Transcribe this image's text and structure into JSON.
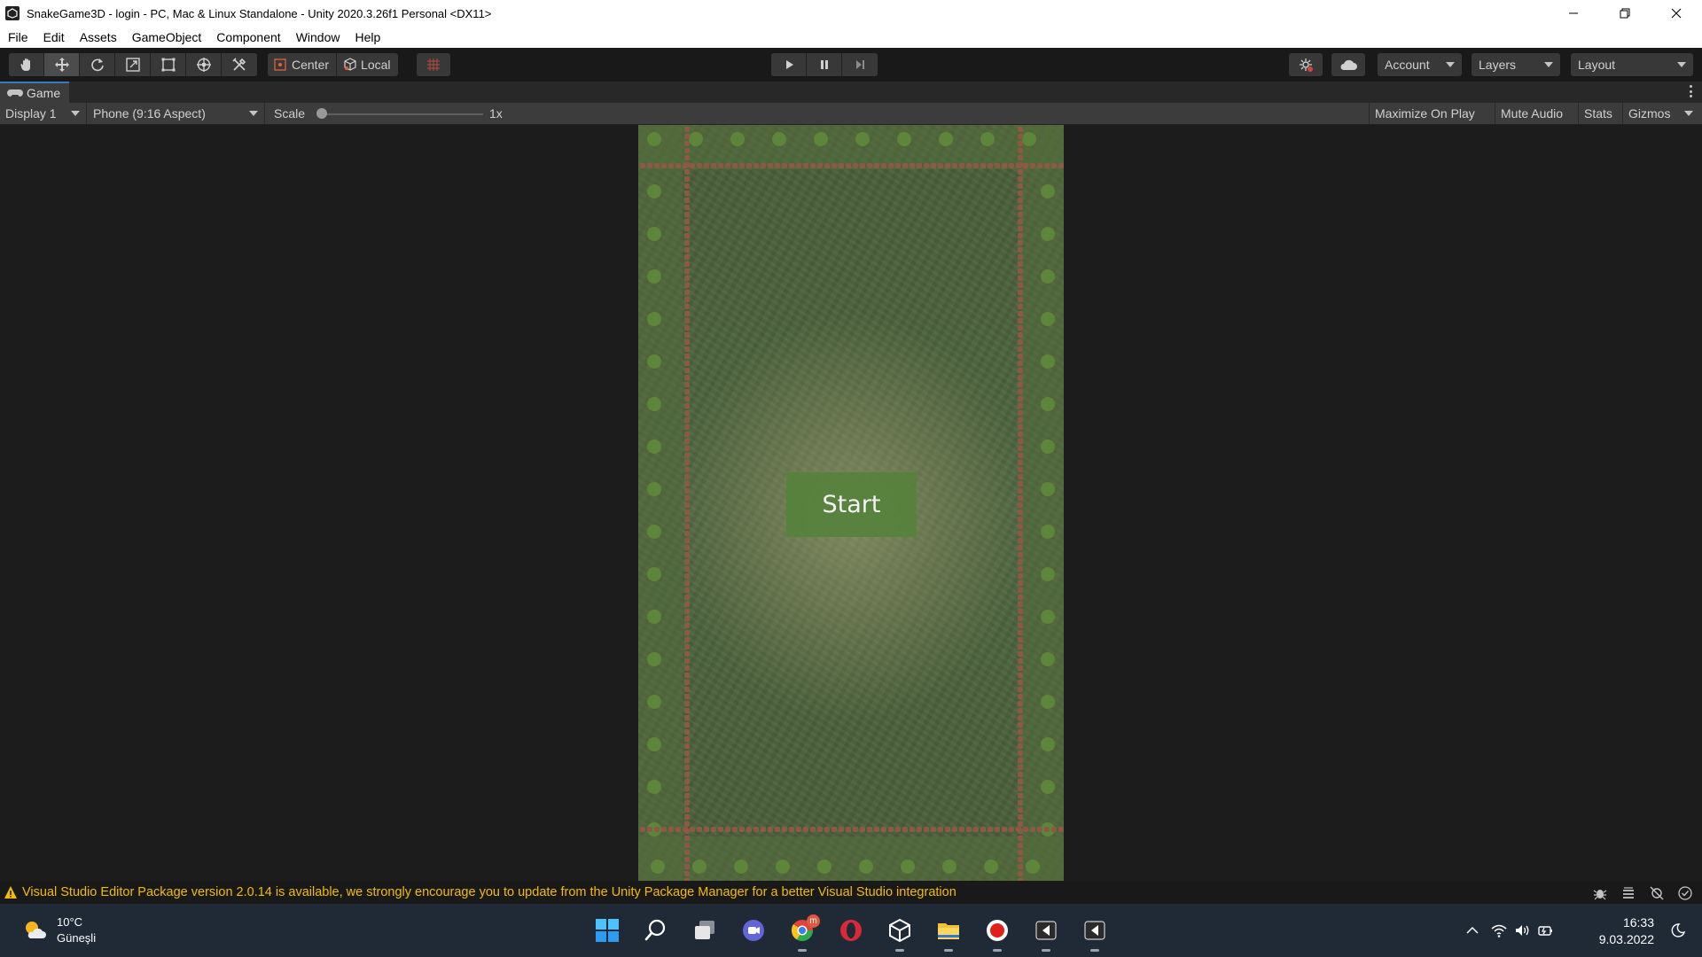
{
  "window": {
    "title": "SnakeGame3D - login - PC, Mac & Linux Standalone - Unity 2020.3.26f1 Personal <DX11>"
  },
  "menu": [
    "File",
    "Edit",
    "Assets",
    "GameObject",
    "Component",
    "Window",
    "Help"
  ],
  "toolbar": {
    "tools": [
      "hand-tool-icon",
      "move-tool-icon",
      "rotate-tool-icon",
      "scale-tool-icon",
      "rect-tool-icon",
      "transform-tool-icon",
      "custom-tool-icon"
    ],
    "active_tool": "move-tool-icon",
    "pivot_mode": "Center",
    "pivot_rotation": "Local",
    "account_label": "Account",
    "layers_label": "Layers",
    "layout_label": "Layout"
  },
  "game_tab": {
    "label": "Game"
  },
  "game_controls": {
    "display": "Display 1",
    "aspect": "Phone (9:16 Aspect)",
    "scale_label": "Scale",
    "scale_value": "1x",
    "scale_level": 0,
    "maximize_on_play": "Maximize On Play",
    "mute_audio": "Mute Audio",
    "stats": "Stats",
    "gizmos": "Gizmos"
  },
  "game_view": {
    "start_button": "Start"
  },
  "console": {
    "message": "Visual Studio Editor Package version 2.0.14 is available, we strongly encourage you to update from the Unity Package Manager for a better Visual Studio integration",
    "warning_color": "#f4bc02"
  },
  "taskbar": {
    "weather_temp": "10°C",
    "weather_desc": "Güneşli",
    "apps": [
      "windows-start-icon",
      "search-icon",
      "task-view-icon",
      "teams-chat-icon",
      "chrome-icon",
      "opera-icon",
      "unity-hub-icon",
      "file-explorer-icon",
      "recorder-icon",
      "visual-studio-icon",
      "visual-studio-icon-2"
    ],
    "chrome_badge": "m",
    "time": "16:33",
    "date": "9.03.2022"
  },
  "colors": {
    "accent_blue": "#3a79bb",
    "taskbar_bg": "#1f2a36"
  }
}
